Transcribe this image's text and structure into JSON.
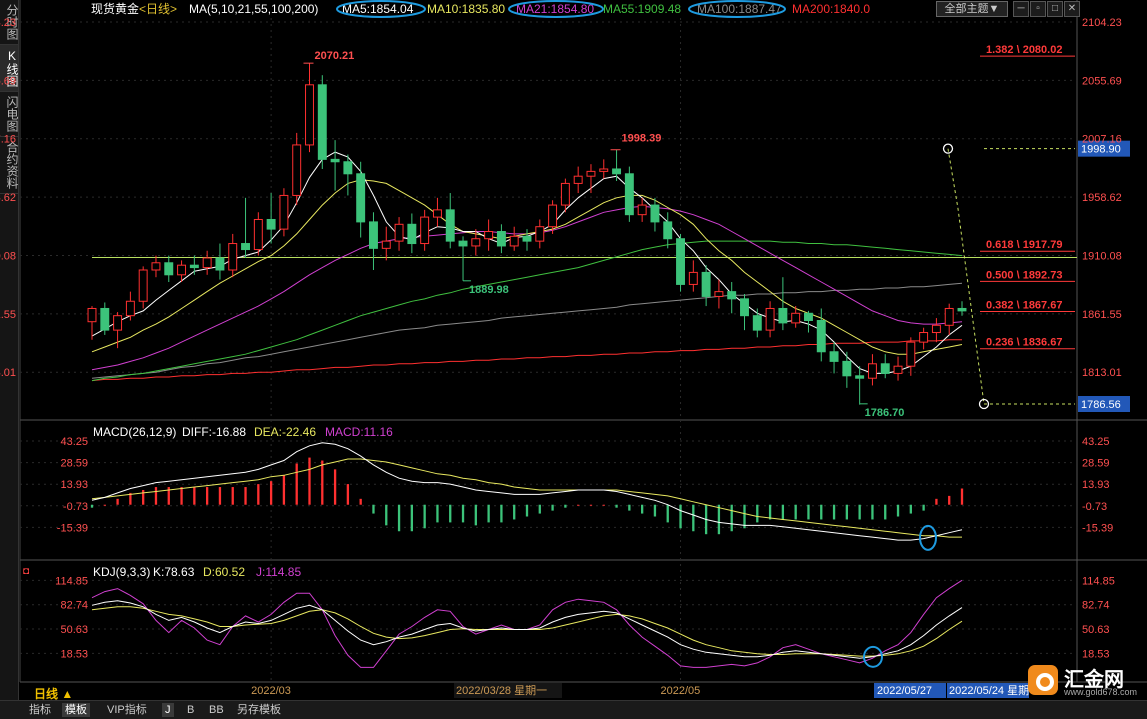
{
  "left_tabs": [
    "分时图",
    "K线图",
    "闪电图",
    "合约资料"
  ],
  "header": {
    "instrument": "现货黄金",
    "period_tag": "<日线>",
    "ma_prefix": "MA(5,10,21,55,100,200)",
    "ma5": "MA5:1854.04",
    "ma10": "MA10:1835.80",
    "ma21": "MA21:1854.80",
    "ma55": "MA55:1909.48",
    "ma100": "MA100:1887.47",
    "ma200": "MA200:1840.0",
    "theme_button": "全部主题▼"
  },
  "colors": {
    "up": "#ff3030",
    "down": "#3cc37a",
    "ma5": "#ffffff",
    "ma10": "#e8e860",
    "ma21": "#d040d0",
    "ma55": "#40c040",
    "ma100": "#8a8a8a",
    "ma200": "#ff3030",
    "fib": "#ff3a3a",
    "circle": "#1e9be0",
    "grid": "#2a2a2a"
  },
  "chart_data": [
    {
      "type": "candlestick",
      "title": "现货黄金 日线",
      "ylim": [
        1786.56,
        2104.23
      ],
      "yticks": [
        "2104.23",
        "2055.69",
        "2007.16",
        "1958.62",
        "1910.08",
        "1861.55",
        "1813.01"
      ],
      "xlabels": [
        "2022/03",
        "2022/03/28 星期一",
        "2022/05"
      ],
      "high_label": "2070.21",
      "mid_high_label": "1998.39",
      "swing_low_label": "1889.98",
      "low_label": "1786.70",
      "price_tags": [
        "1998.90",
        "1786.56"
      ],
      "fib_levels": [
        {
          "label": "1.382 \\ 2080.02",
          "value": 2080.02
        },
        {
          "label": "0.618 \\ 1917.79",
          "value": 1917.79
        },
        {
          "label": "0.500 \\ 1892.73",
          "value": 1892.73
        },
        {
          "label": "0.382 \\ 1867.67",
          "value": 1867.67
        },
        {
          "label": "0.236 \\ 1836.67",
          "value": 1836.67
        }
      ],
      "candles": [
        [
          1855,
          1866,
          1840,
          1868
        ],
        [
          1866,
          1848,
          1844,
          1871
        ],
        [
          1848,
          1860,
          1833,
          1863
        ],
        [
          1860,
          1872,
          1856,
          1880
        ],
        [
          1872,
          1898,
          1866,
          1901
        ],
        [
          1898,
          1904,
          1892,
          1910
        ],
        [
          1904,
          1894,
          1888,
          1910
        ],
        [
          1894,
          1902,
          1888,
          1906
        ],
        [
          1902,
          1900,
          1894,
          1910
        ],
        [
          1900,
          1908,
          1894,
          1914
        ],
        [
          1908,
          1898,
          1890,
          1920
        ],
        [
          1898,
          1920,
          1892,
          1928
        ],
        [
          1920,
          1915,
          1908,
          1958
        ],
        [
          1915,
          1940,
          1910,
          1946
        ],
        [
          1940,
          1932,
          1920,
          1962
        ],
        [
          1932,
          1960,
          1926,
          1966
        ],
        [
          1960,
          2002,
          1952,
          2012
        ],
        [
          2002,
          2052,
          1996,
          2070
        ],
        [
          2052,
          1990,
          1982,
          2060
        ],
        [
          1990,
          1988,
          1964,
          2006
        ],
        [
          1988,
          1978,
          1960,
          1994
        ],
        [
          1978,
          1938,
          1925,
          1988
        ],
        [
          1938,
          1916,
          1898,
          1946
        ],
        [
          1916,
          1922,
          1906,
          1934
        ],
        [
          1922,
          1936,
          1914,
          1942
        ],
        [
          1936,
          1920,
          1912,
          1945
        ],
        [
          1920,
          1942,
          1914,
          1948
        ],
        [
          1942,
          1948,
          1934,
          1958
        ],
        [
          1948,
          1922,
          1916,
          1962
        ],
        [
          1922,
          1918,
          1889,
          1926
        ],
        [
          1918,
          1924,
          1910,
          1932
        ],
        [
          1924,
          1930,
          1914,
          1940
        ],
        [
          1930,
          1918,
          1912,
          1936
        ],
        [
          1918,
          1926,
          1914,
          1934
        ],
        [
          1926,
          1922,
          1914,
          1932
        ],
        [
          1922,
          1934,
          1916,
          1940
        ],
        [
          1934,
          1952,
          1928,
          1956
        ],
        [
          1952,
          1970,
          1946,
          1974
        ],
        [
          1970,
          1976,
          1962,
          1984
        ],
        [
          1976,
          1980,
          1962,
          1986
        ],
        [
          1980,
          1982,
          1974,
          1990
        ],
        [
          1982,
          1978,
          1972,
          1998
        ],
        [
          1978,
          1944,
          1938,
          1984
        ],
        [
          1944,
          1952,
          1938,
          1958
        ],
        [
          1952,
          1938,
          1930,
          1958
        ],
        [
          1938,
          1924,
          1916,
          1946
        ],
        [
          1924,
          1886,
          1880,
          1928
        ],
        [
          1886,
          1896,
          1880,
          1906
        ],
        [
          1896,
          1876,
          1868,
          1902
        ],
        [
          1876,
          1880,
          1866,
          1890
        ],
        [
          1880,
          1874,
          1862,
          1888
        ],
        [
          1874,
          1860,
          1848,
          1878
        ],
        [
          1860,
          1848,
          1842,
          1866
        ],
        [
          1848,
          1866,
          1842,
          1872
        ],
        [
          1866,
          1854,
          1848,
          1892
        ],
        [
          1854,
          1862,
          1850,
          1868
        ],
        [
          1862,
          1856,
          1846,
          1864
        ],
        [
          1856,
          1830,
          1822,
          1866
        ],
        [
          1830,
          1822,
          1812,
          1838
        ],
        [
          1822,
          1810,
          1800,
          1830
        ],
        [
          1810,
          1808,
          1786,
          1818
        ],
        [
          1808,
          1820,
          1802,
          1828
        ],
        [
          1820,
          1812,
          1808,
          1828
        ],
        [
          1812,
          1818,
          1806,
          1826
        ],
        [
          1818,
          1838,
          1810,
          1842
        ],
        [
          1838,
          1846,
          1832,
          1850
        ],
        [
          1846,
          1852,
          1838,
          1858
        ],
        [
          1852,
          1866,
          1844,
          1870
        ],
        [
          1866,
          1864,
          1860,
          1872
        ]
      ],
      "ma5": [
        1843,
        1849,
        1855,
        1860,
        1864,
        1873,
        1881,
        1889,
        1897,
        1899,
        1901,
        1907,
        1910,
        1913,
        1923,
        1935,
        1954,
        1975,
        1990,
        1996,
        1992,
        1980,
        1960,
        1938,
        1926,
        1923,
        1929,
        1934,
        1933,
        1930,
        1930,
        1924,
        1920,
        1925,
        1926,
        1930,
        1936,
        1948,
        1958,
        1966,
        1974,
        1976,
        1966,
        1958,
        1948,
        1938,
        1924,
        1914,
        1900,
        1890,
        1878,
        1870,
        1862,
        1858,
        1855,
        1856,
        1853,
        1848,
        1838,
        1826,
        1816,
        1812,
        1812,
        1814,
        1818,
        1826,
        1834,
        1844,
        1852
      ],
      "ma10": [
        1830,
        1834,
        1838,
        1842,
        1848,
        1853,
        1859,
        1866,
        1873,
        1880,
        1887,
        1893,
        1899,
        1905,
        1910,
        1918,
        1928,
        1940,
        1952,
        1962,
        1970,
        1973,
        1972,
        1970,
        1964,
        1958,
        1952,
        1944,
        1936,
        1930,
        1928,
        1926,
        1924,
        1926,
        1928,
        1930,
        1932,
        1936,
        1942,
        1948,
        1954,
        1958,
        1960,
        1960,
        1956,
        1950,
        1944,
        1936,
        1924,
        1914,
        1906,
        1896,
        1888,
        1880,
        1872,
        1866,
        1862,
        1858,
        1852,
        1846,
        1840,
        1834,
        1830,
        1828,
        1828,
        1830,
        1832,
        1834,
        1836
      ],
      "ma21": [
        1815,
        1817,
        1819,
        1822,
        1825,
        1829,
        1833,
        1838,
        1843,
        1848,
        1853,
        1858,
        1863,
        1868,
        1874,
        1880,
        1887,
        1894,
        1900,
        1906,
        1911,
        1916,
        1920,
        1922,
        1924,
        1925,
        1926,
        1927,
        1928,
        1929,
        1930,
        1930,
        1929,
        1928,
        1928,
        1929,
        1931,
        1934,
        1938,
        1942,
        1946,
        1948,
        1950,
        1951,
        1950,
        1949,
        1947,
        1944,
        1940,
        1936,
        1930,
        1924,
        1918,
        1912,
        1906,
        1900,
        1894,
        1888,
        1882,
        1876,
        1870,
        1864,
        1860,
        1856,
        1854,
        1853,
        1853,
        1854,
        1855
      ],
      "ma55": [
        1806,
        1808,
        1809,
        1811,
        1812,
        1814,
        1816,
        1818,
        1820,
        1822,
        1824,
        1826,
        1828,
        1831,
        1834,
        1837,
        1840,
        1844,
        1848,
        1852,
        1856,
        1860,
        1863,
        1866,
        1869,
        1872,
        1874,
        1877,
        1879,
        1882,
        1884,
        1886,
        1888,
        1890,
        1892,
        1894,
        1896,
        1898,
        1900,
        1903,
        1906,
        1909,
        1912,
        1915,
        1917,
        1919,
        1920,
        1921,
        1922,
        1922,
        1922,
        1922,
        1922,
        1922,
        1921,
        1921,
        1920,
        1920,
        1919,
        1919,
        1918,
        1917,
        1916,
        1915,
        1914,
        1913,
        1912,
        1911,
        1910
      ],
      "ma100": [
        1808,
        1809,
        1810,
        1811,
        1812,
        1813,
        1815,
        1817,
        1818,
        1820,
        1821,
        1823,
        1825,
        1826,
        1828,
        1830,
        1832,
        1834,
        1836,
        1838,
        1840,
        1842,
        1844,
        1846,
        1848,
        1849,
        1850,
        1852,
        1853,
        1854,
        1855,
        1856,
        1858,
        1859,
        1860,
        1861,
        1862,
        1863,
        1864,
        1865,
        1866,
        1867,
        1869,
        1870,
        1871,
        1872,
        1873,
        1874,
        1875,
        1876,
        1877,
        1877,
        1878,
        1878,
        1879,
        1879,
        1880,
        1880,
        1881,
        1881,
        1882,
        1882,
        1883,
        1883,
        1884,
        1884,
        1885,
        1886,
        1887
      ],
      "ma200": [
        1806,
        1807,
        1807,
        1808,
        1808,
        1809,
        1809,
        1810,
        1810,
        1811,
        1811,
        1812,
        1812,
        1813,
        1813,
        1814,
        1815,
        1815,
        1816,
        1817,
        1817,
        1818,
        1819,
        1819,
        1820,
        1820,
        1821,
        1821,
        1822,
        1822,
        1823,
        1823,
        1824,
        1824,
        1825,
        1825,
        1826,
        1826,
        1827,
        1827,
        1828,
        1828,
        1829,
        1829,
        1830,
        1830,
        1831,
        1831,
        1832,
        1832,
        1833,
        1833,
        1834,
        1834,
        1835,
        1835,
        1836,
        1836,
        1837,
        1837,
        1837,
        1838,
        1838,
        1838,
        1839,
        1839,
        1839,
        1840,
        1840
      ]
    },
    {
      "type": "macd",
      "title": "MACD(26,12,9)",
      "diff_label": "DIFF:-16.88",
      "dea_label": "DEA:-22.46",
      "macd_label": "MACD:11.16",
      "yticks": [
        "43.25",
        "28.59",
        "13.93",
        "-0.73",
        "-15.39"
      ],
      "ylim": [
        -30.05,
        43.25
      ],
      "diff": [
        3,
        5,
        8,
        11,
        13,
        15,
        16,
        17,
        18,
        19,
        20,
        21,
        22,
        24,
        27,
        30,
        36,
        40,
        42,
        41,
        38,
        33,
        27,
        22,
        18,
        16,
        15,
        15,
        14,
        12,
        10,
        9,
        8,
        7,
        7,
        7,
        8,
        9,
        10,
        10,
        10,
        9,
        7,
        5,
        3,
        0,
        -4,
        -7,
        -10,
        -12,
        -13,
        -14,
        -14,
        -14,
        -15,
        -16,
        -17,
        -18,
        -19,
        -20,
        -21,
        -22,
        -23,
        -24,
        -24,
        -23,
        -21,
        -19,
        -17
      ],
      "dea": [
        4,
        5,
        6,
        7,
        8,
        9,
        10,
        11,
        12,
        13,
        14,
        15,
        16,
        17,
        19,
        20,
        22,
        24,
        27,
        29,
        31,
        31,
        30,
        29,
        27,
        25,
        23,
        21,
        20,
        18,
        17,
        15,
        14,
        12,
        11,
        10,
        10,
        10,
        10,
        10,
        10,
        10,
        9,
        8,
        7,
        6,
        4,
        2,
        0,
        -2,
        -4,
        -6,
        -8,
        -9,
        -10,
        -11,
        -12,
        -13,
        -14,
        -15,
        -16,
        -17,
        -18,
        -19,
        -20,
        -21,
        -21,
        -22,
        -22
      ],
      "hist": [
        -2,
        0,
        4,
        8,
        10,
        12,
        12,
        12,
        12,
        12,
        12,
        12,
        12,
        14,
        16,
        20,
        28,
        32,
        30,
        24,
        14,
        4,
        -6,
        -14,
        -18,
        -18,
        -16,
        -12,
        -12,
        -12,
        -14,
        -12,
        -12,
        -10,
        -8,
        -6,
        -4,
        -2,
        0,
        0,
        0,
        -2,
        -4,
        -6,
        -8,
        -12,
        -16,
        -18,
        -20,
        -20,
        -18,
        -16,
        -12,
        -10,
        -10,
        -10,
        -10,
        -10,
        -10,
        -10,
        -10,
        -10,
        -10,
        -8,
        -6,
        -4,
        4,
        6,
        11
      ]
    },
    {
      "type": "kdj",
      "title": "KDJ(9,3,3)",
      "k_label": "K:78.63",
      "d_label": "D:60.52",
      "j_label": "J:114.85",
      "yticks": [
        "114.85",
        "82.74",
        "50.63",
        "18.53"
      ],
      "ylim": [
        -10,
        118
      ],
      "k": [
        82,
        86,
        88,
        85,
        80,
        70,
        62,
        66,
        60,
        52,
        46,
        54,
        60,
        58,
        62,
        70,
        78,
        82,
        76,
        62,
        48,
        36,
        30,
        34,
        40,
        44,
        50,
        56,
        58,
        52,
        48,
        50,
        52,
        50,
        50,
        52,
        60,
        66,
        70,
        72,
        74,
        72,
        64,
        56,
        48,
        40,
        30,
        24,
        20,
        18,
        16,
        14,
        14,
        16,
        20,
        22,
        20,
        18,
        16,
        14,
        12,
        14,
        18,
        22,
        30,
        42,
        56,
        68,
        79
      ],
      "d": [
        76,
        78,
        80,
        80,
        78,
        74,
        70,
        68,
        64,
        60,
        54,
        54,
        56,
        57,
        58,
        62,
        68,
        74,
        76,
        72,
        64,
        54,
        45,
        40,
        38,
        39,
        42,
        46,
        50,
        51,
        50,
        50,
        50,
        50,
        50,
        50,
        52,
        56,
        60,
        64,
        68,
        70,
        68,
        64,
        58,
        52,
        44,
        36,
        30,
        26,
        22,
        20,
        18,
        17,
        17,
        18,
        18,
        18,
        17,
        16,
        15,
        15,
        16,
        18,
        22,
        28,
        38,
        50,
        61
      ],
      "j": [
        92,
        100,
        104,
        95,
        84,
        62,
        46,
        62,
        52,
        36,
        30,
        54,
        68,
        60,
        70,
        86,
        98,
        98,
        76,
        42,
        16,
        0,
        0,
        22,
        44,
        54,
        66,
        76,
        74,
        54,
        44,
        50,
        56,
        50,
        50,
        56,
        76,
        86,
        90,
        88,
        86,
        76,
        56,
        40,
        28,
        16,
        2,
        0,
        0,
        2,
        4,
        2,
        6,
        14,
        26,
        30,
        24,
        18,
        14,
        10,
        6,
        12,
        22,
        30,
        46,
        70,
        92,
        104,
        115
      ]
    },
    {
      "type": "time_axis",
      "labels": [
        "2022/03",
        "2022/03/28 星期一",
        "2022/05"
      ],
      "cursor_dates": [
        "2022/05/27",
        "2022/05/24 星期"
      ]
    }
  ],
  "bottom_tabs": [
    "指标",
    "模板",
    "VIP指标",
    "J",
    "B",
    "BB",
    "另存模板"
  ],
  "period": "日线 ▲",
  "logo": {
    "name": "汇金网",
    "url": "www.gold678.com"
  }
}
